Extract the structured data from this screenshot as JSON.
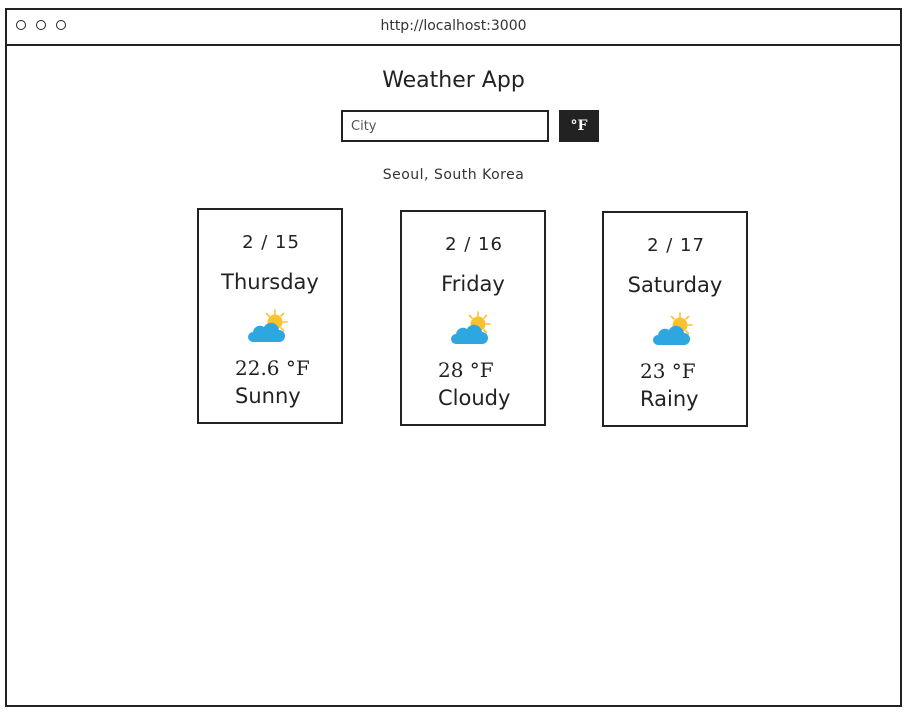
{
  "browser": {
    "url": "http://localhost:3000"
  },
  "app": {
    "title": "Weather App",
    "search": {
      "placeholder": "City",
      "value": ""
    },
    "unit_button_label": "°F",
    "location": "Seoul, South Korea"
  },
  "forecast": [
    {
      "date": "2 / 15",
      "day": "Thursday",
      "icon": "partly-cloudy-sun-icon",
      "temp": "22.6 °F",
      "condition": "Sunny"
    },
    {
      "date": "2 / 16",
      "day": "Friday",
      "icon": "partly-cloudy-sun-icon",
      "temp": "28 °F",
      "condition": "Cloudy"
    },
    {
      "date": "2 / 17",
      "day": "Saturday",
      "icon": "partly-cloudy-sun-icon",
      "temp": "23 °F",
      "condition": "Rainy"
    }
  ],
  "colors": {
    "sun": "#F9C22E",
    "cloud": "#2EA7E0",
    "button_bg": "#222222"
  }
}
